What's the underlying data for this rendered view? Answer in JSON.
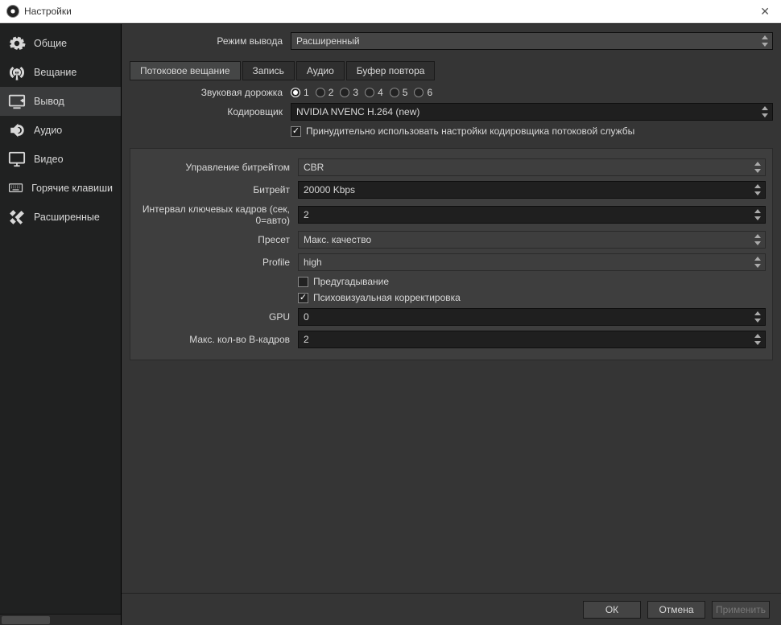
{
  "window": {
    "title": "Настройки"
  },
  "sidebar": {
    "items": [
      {
        "label": "Общие"
      },
      {
        "label": "Вещание"
      },
      {
        "label": "Вывод"
      },
      {
        "label": "Аудио"
      },
      {
        "label": "Видео"
      },
      {
        "label": "Горячие клавиши"
      },
      {
        "label": "Расширенные"
      }
    ]
  },
  "output_mode": {
    "label": "Режим вывода",
    "value": "Расширенный"
  },
  "tabs": [
    {
      "label": "Потоковое вещание"
    },
    {
      "label": "Запись"
    },
    {
      "label": "Аудио"
    },
    {
      "label": "Буфер повтора"
    }
  ],
  "audio_track": {
    "label": "Звуковая дорожка",
    "options": [
      "1",
      "2",
      "3",
      "4",
      "5",
      "6"
    ],
    "selected": "1"
  },
  "encoder": {
    "label": "Кодировщик",
    "value": "NVIDIA NVENC H.264 (new)"
  },
  "enforce": {
    "label": "Принудительно использовать настройки кодировщика потоковой службы",
    "checked": true
  },
  "panel": {
    "rate_control": {
      "label": "Управление битрейтом",
      "value": "CBR"
    },
    "bitrate": {
      "label": "Битрейт",
      "value": "20000 Kbps"
    },
    "keyint": {
      "label": "Интервал ключевых кадров (сек, 0=авто)",
      "value": "2"
    },
    "preset": {
      "label": "Пресет",
      "value": "Макс. качество"
    },
    "profile": {
      "label": "Profile",
      "value": "high"
    },
    "lookahead": {
      "label": "Предугадывание",
      "checked": false
    },
    "psycho": {
      "label": "Психовизуальная корректировка",
      "checked": true
    },
    "gpu": {
      "label": "GPU",
      "value": "0"
    },
    "bframes": {
      "label": "Макс. кол-во B-кадров",
      "value": "2"
    }
  },
  "buttons": {
    "ok": "ОК",
    "cancel": "Отмена",
    "apply": "Применить"
  }
}
